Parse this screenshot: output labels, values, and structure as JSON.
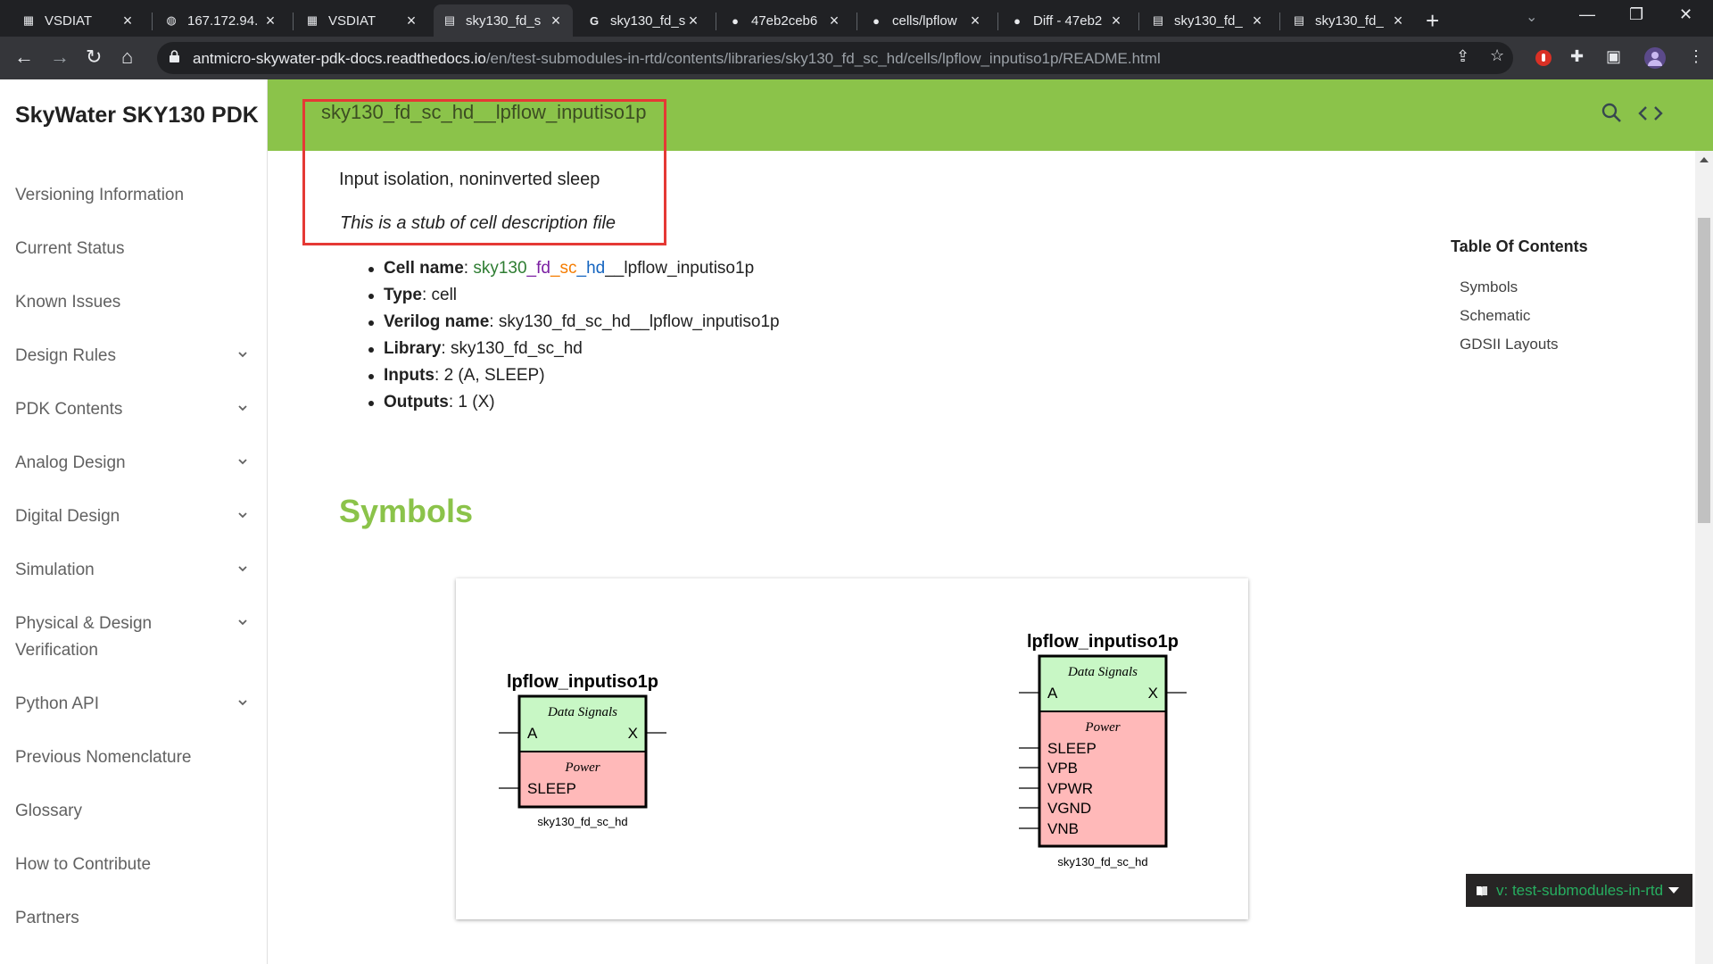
{
  "browser": {
    "tabs": [
      {
        "title": "VSDIAT",
        "icon": "grid-app-icon"
      },
      {
        "title": "167.172.94.",
        "icon": "globe-icon"
      },
      {
        "title": "VSDIAT",
        "icon": "grid-app-icon"
      },
      {
        "title": "sky130_fd_s",
        "icon": "docs-icon",
        "active": true
      },
      {
        "title": "sky130_fd_s",
        "icon": "google-icon"
      },
      {
        "title": "47eb2ceb6",
        "icon": "github-icon"
      },
      {
        "title": "cells/lpflow",
        "icon": "github-icon"
      },
      {
        "title": "Diff - 47eb2",
        "icon": "github-icon"
      },
      {
        "title": "sky130_fd_",
        "icon": "docs-icon"
      },
      {
        "title": "sky130_fd_",
        "icon": "docs-icon"
      }
    ],
    "url_host": "antmicro-skywater-pdk-docs.readthedocs.io",
    "url_path": "/en/test-submodules-in-rtd/contents/libraries/sky130_fd_sc_hd/cells/lpflow_inputiso1p/README.html"
  },
  "sidebar": {
    "title": "SkyWater SKY130 PDK",
    "items": [
      {
        "label": "Versioning Information",
        "expandable": false
      },
      {
        "label": "Current Status",
        "expandable": false
      },
      {
        "label": "Known Issues",
        "expandable": false
      },
      {
        "label": "Design Rules",
        "expandable": true
      },
      {
        "label": "PDK Contents",
        "expandable": true
      },
      {
        "label": "Analog Design",
        "expandable": true
      },
      {
        "label": "Digital Design",
        "expandable": true
      },
      {
        "label": "Simulation",
        "expandable": true
      },
      {
        "label": "Physical & Design Verification",
        "expandable": true
      },
      {
        "label": "Python API",
        "expandable": true
      },
      {
        "label": "Previous Nomenclature",
        "expandable": false
      },
      {
        "label": "Glossary",
        "expandable": false
      },
      {
        "label": "How to Contribute",
        "expandable": false
      },
      {
        "label": "Partners",
        "expandable": false
      }
    ]
  },
  "header": {
    "title": "sky130_fd_sc_hd__lpflow_inputiso1p"
  },
  "content": {
    "subtitle": "Input isolation, noninverted sleep",
    "stub_note": "This is a stub of cell description file",
    "properties": {
      "cell_name_label": "Cell name",
      "cell_name_parts": [
        "sky130",
        "_fd",
        "_sc",
        "_hd",
        "__lpflow_inputiso1p"
      ],
      "type_label": "Type",
      "type_value": "cell",
      "verilog_label": "Verilog name",
      "verilog_value": "sky130_fd_sc_hd__lpflow_inputiso1p",
      "library_label": "Library",
      "library_value": "sky130_fd_sc_hd",
      "inputs_label": "Inputs",
      "inputs_value": "2 (A, SLEEP)",
      "outputs_label": "Outputs",
      "outputs_value": "1 (X)"
    },
    "symbols_heading": "Symbols",
    "symbols": [
      {
        "name": "lpflow_inputiso1p",
        "data_label": "Data Signals",
        "input_pin": "A",
        "output_pin": "X",
        "power_label": "Power",
        "power_pins": [
          "SLEEP"
        ],
        "library": "sky130_fd_sc_hd"
      },
      {
        "name": "lpflow_inputiso1p",
        "data_label": "Data Signals",
        "input_pin": "A",
        "output_pin": "X",
        "power_label": "Power",
        "power_pins": [
          "SLEEP",
          "VPB",
          "VPWR",
          "VGND",
          "VNB"
        ],
        "library": "sky130_fd_sc_hd"
      }
    ]
  },
  "toc": {
    "title": "Table Of Contents",
    "items": [
      "Symbols",
      "Schematic",
      "GDSII Layouts"
    ]
  },
  "version_badge": {
    "label": "v: test-submodules-in-rtd"
  },
  "colors": {
    "header_green": "#8bc34a",
    "highlight_red": "#e53935",
    "data_signals_fill": "#c8f7c5",
    "power_fill": "#ffb9b9",
    "badge_text": "#27ae60"
  }
}
